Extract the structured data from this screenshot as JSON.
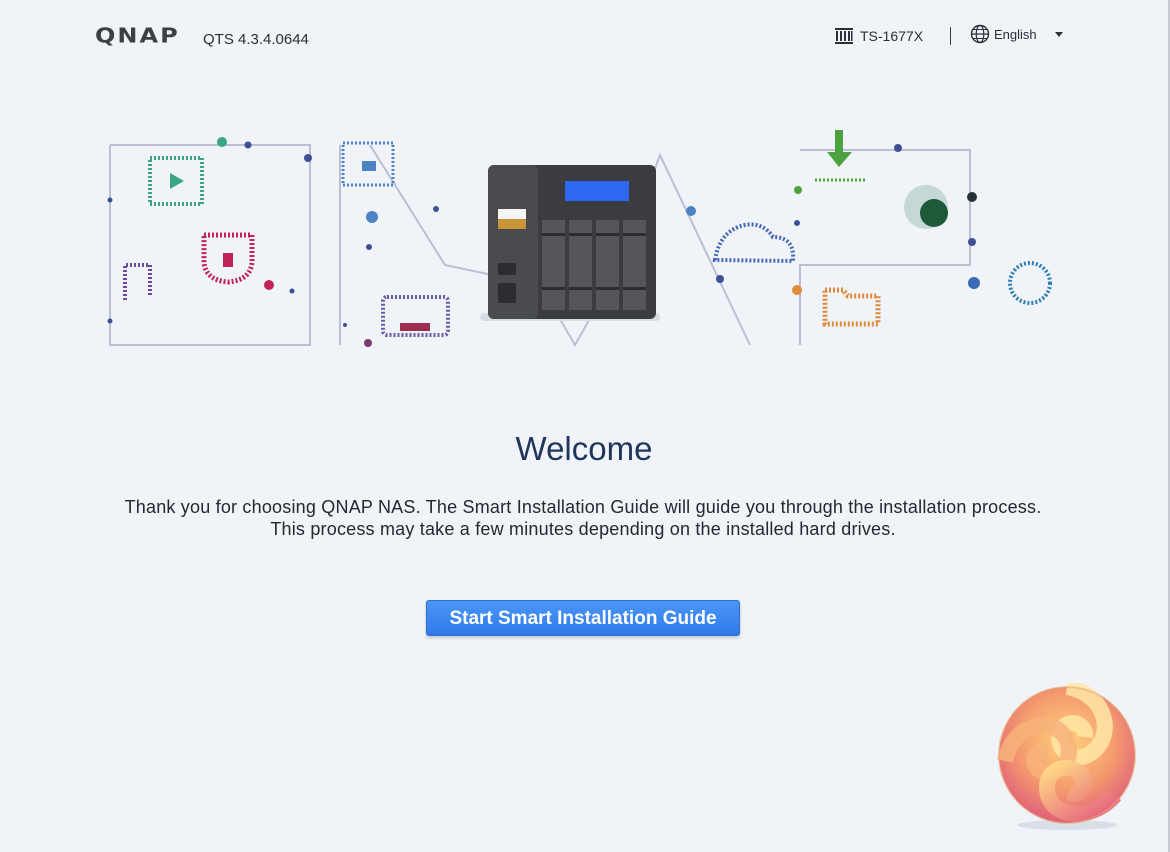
{
  "header": {
    "brand": "QNAP",
    "version": "QTS 4.3.4.0644",
    "model": "TS-1677X",
    "language": "English"
  },
  "welcome": {
    "title": "Welcome",
    "description": "Thank you for choosing QNAP NAS. The Smart Installation Guide will guide you through the installation process. This process may take a few minutes depending on the installed hard drives.",
    "start_button_label": "Start Smart Installation Guide"
  },
  "icons": {
    "model": "server-rack-icon",
    "language": "globe-icon",
    "dropdown": "caret-down-icon"
  },
  "colors": {
    "background": "#f0f4f8",
    "button": "#3a86f0",
    "title": "#1f3559"
  }
}
